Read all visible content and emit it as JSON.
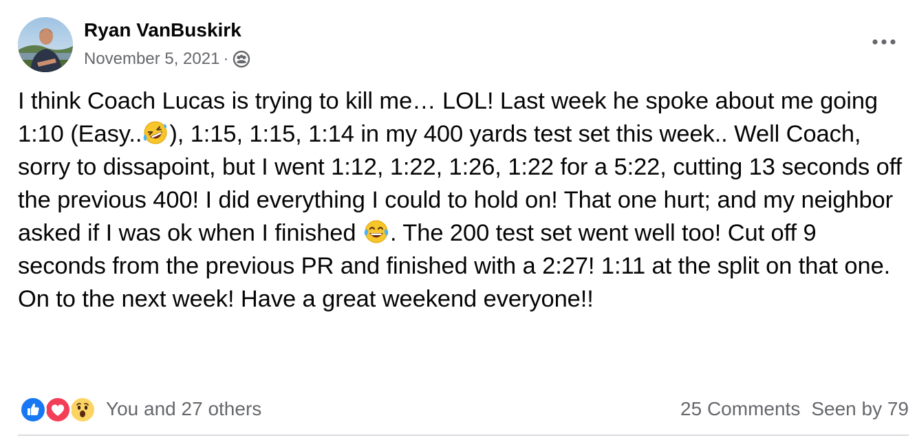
{
  "post": {
    "author": "Ryan VanBuskirk",
    "date": "November 5, 2021",
    "separator": "·",
    "audience_icon": "friends-group-icon",
    "more_icon": "more-options-icon",
    "body": {
      "p1": "I think Coach Lucas is trying to kill me… LOL! Last week he spoke about me going 1:10 (Easy..",
      "emoji1": "rolling-on-floor-laughing",
      "p2": "), 1:15, 1:15, 1:14 in my 400 yards test set this week.. Well Coach, sorry to dissapoint, but I went 1:12, 1:22, 1:26, 1:22 for a 5:22, cutting 13 seconds off the previous 400! I did everything I could to hold on! That one hurt; and my neighbor asked if I was ok when I finished ",
      "emoji2": "face-with-tears-of-joy",
      "p3": ". The 200 test set went well too! Cut off 9 seconds from the previous PR and finished with a 2:27! 1:11 at the split on that one. On to the next week! Have a great weekend everyone!!"
    },
    "footer": {
      "reactions": [
        "like",
        "love",
        "wow"
      ],
      "reaction_summary": "You and 27 others",
      "comments": "25 Comments",
      "seen_by": "Seen by 79"
    }
  },
  "colors": {
    "text": "#050505",
    "secondary": "#65676b",
    "like_blue": "#1877f2",
    "love_red": "#f33e58",
    "wow_yellow": "#fcd464"
  }
}
